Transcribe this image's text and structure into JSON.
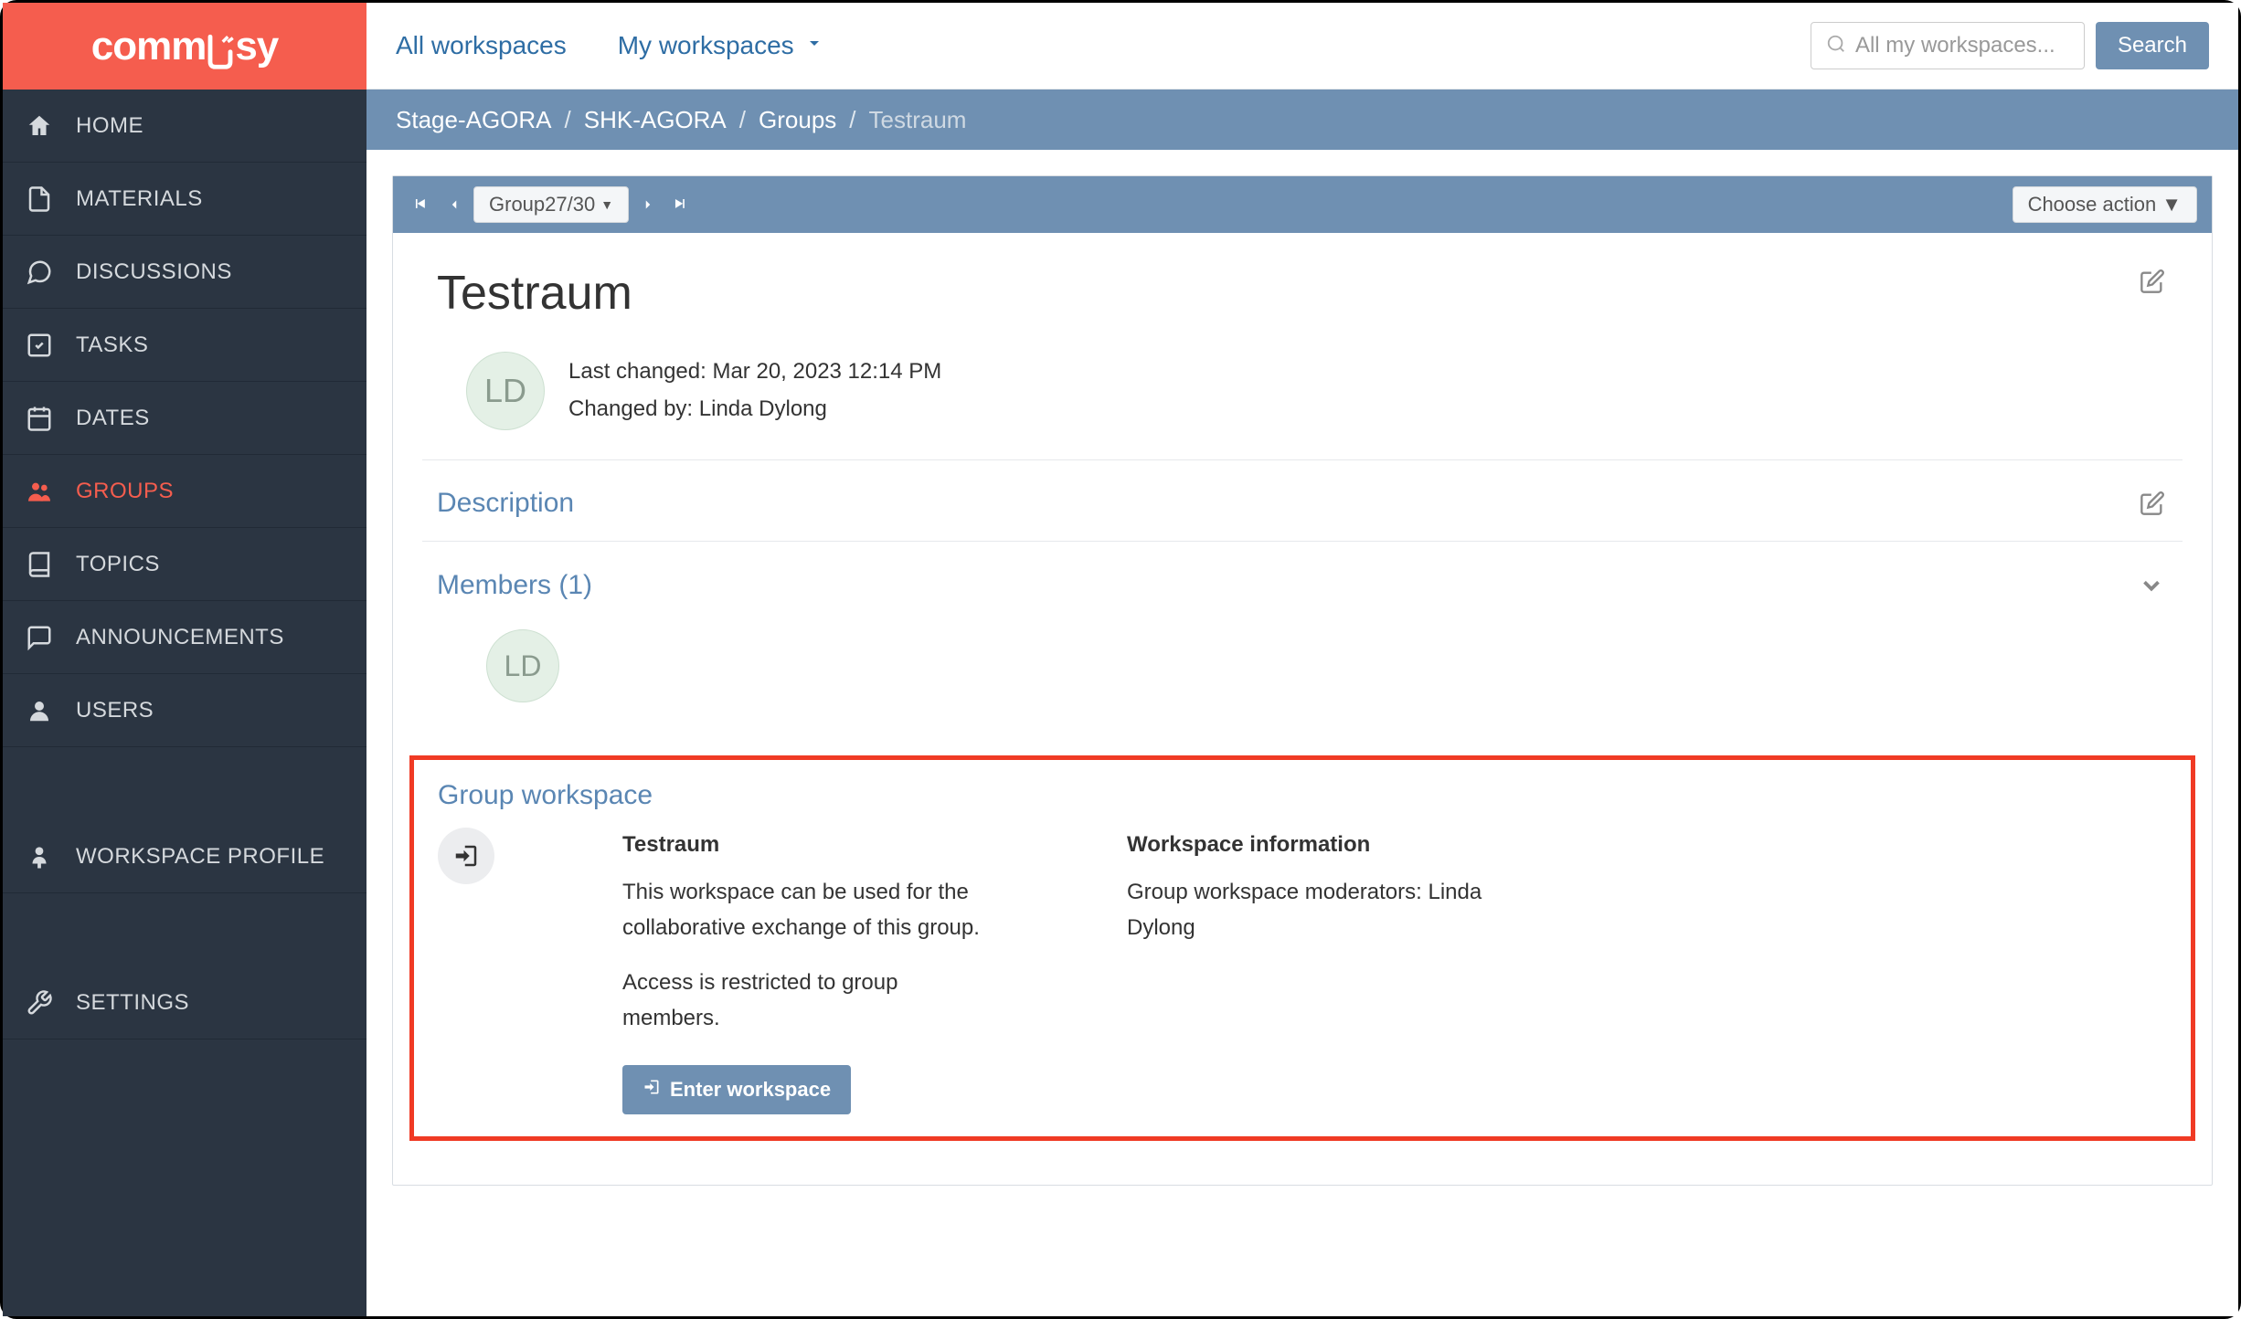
{
  "logo": "commsy",
  "sidebar": {
    "items": [
      {
        "label": "HOME",
        "active": false
      },
      {
        "label": "MATERIALS",
        "active": false
      },
      {
        "label": "DISCUSSIONS",
        "active": false
      },
      {
        "label": "TASKS",
        "active": false
      },
      {
        "label": "DATES",
        "active": false
      },
      {
        "label": "GROUPS",
        "active": true
      },
      {
        "label": "TOPICS",
        "active": false
      },
      {
        "label": "ANNOUNCEMENTS",
        "active": false
      },
      {
        "label": "USERS",
        "active": false
      }
    ],
    "profile_label": "WORKSPACE PROFILE",
    "settings_label": "SETTINGS"
  },
  "topbar": {
    "all_workspaces": "All workspaces",
    "my_workspaces": "My workspaces",
    "search_placeholder": "All my workspaces...",
    "search_button": "Search"
  },
  "breadcrumb": {
    "items": [
      "Stage-AGORA",
      "SHK-AGORA",
      "Groups"
    ],
    "current": "Testraum"
  },
  "pager": {
    "group_label": "Group27/30",
    "choose_action": "Choose action"
  },
  "group": {
    "title": "Testraum",
    "avatar_initials": "LD",
    "last_changed_label": "Last changed:",
    "last_changed_value": "Mar 20, 2023 12:14 PM",
    "changed_by_label": "Changed by:",
    "changed_by_value": "Linda Dylong"
  },
  "sections": {
    "description_title": "Description",
    "members_title": "Members (1)",
    "member_initials": "LD"
  },
  "workspace": {
    "section_title": "Group workspace",
    "name": "Testraum",
    "desc1": "This workspace can be used for the collaborative exchange of this group.",
    "desc2": "Access is restricted to group members.",
    "info_title": "Workspace information",
    "info_text": "Group workspace moderators: Linda Dylong",
    "enter_button": "Enter workspace"
  }
}
